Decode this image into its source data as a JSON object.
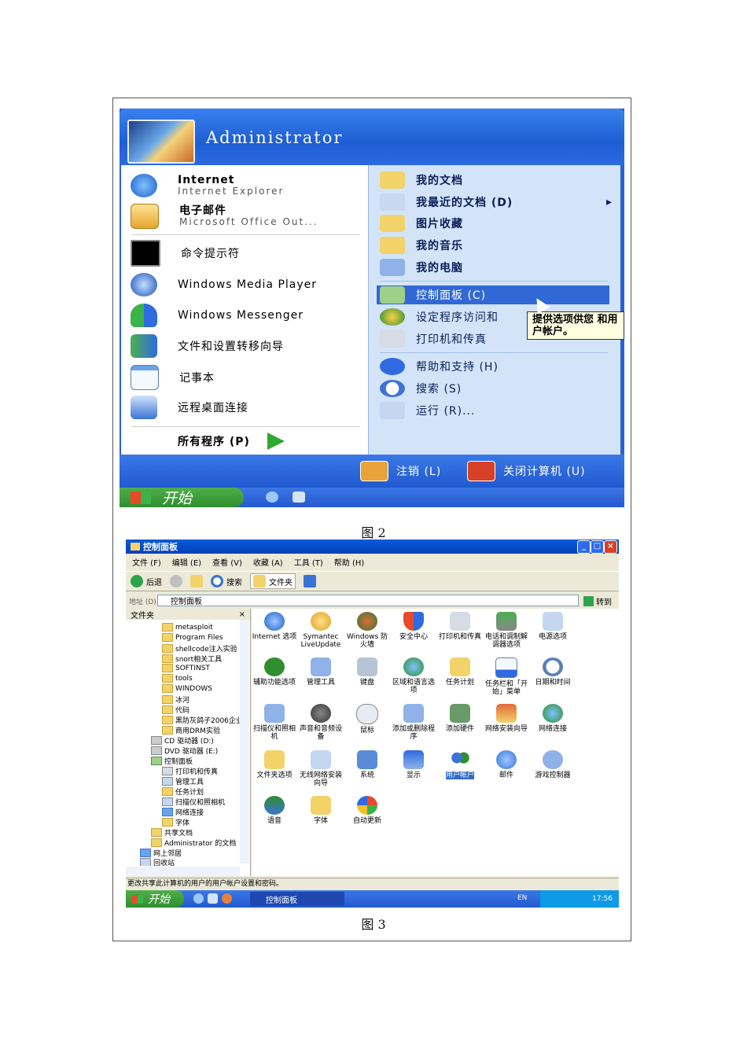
{
  "figure2": {
    "caption": "图 2",
    "user_name": "Administrator",
    "pinned": [
      {
        "title": "Internet",
        "subtitle": "Internet Explorer"
      },
      {
        "title": "电子邮件",
        "subtitle": "Microsoft Office Out..."
      }
    ],
    "recent": [
      "命令提示符",
      "Windows Media Player",
      "Windows Messenger",
      "文件和设置转移向导",
      "记事本",
      "远程桌面连接"
    ],
    "all_programs": "所有程序 (P)",
    "right_items": [
      "我的文档",
      "我最近的文档 (D)",
      "图片收藏",
      "我的音乐",
      "我的电脑",
      "控制面板 (C)",
      "设定程序访问和",
      "打印机和传真",
      "帮助和支持 (H)",
      "搜索 (S)",
      "运行 (R)..."
    ],
    "submenu_arrow": "▸",
    "tooltip": "提供选项供您 和用户帐户。",
    "logoff": "注销 (L)",
    "shutdown": "关闭计算机 (U)",
    "start": "开始"
  },
  "figure3": {
    "caption": "图 3",
    "window_title": "控制面板",
    "menu": [
      "文件 (F)",
      "编辑 (E)",
      "查看 (V)",
      "收藏 (A)",
      "工具 (T)",
      "帮助 (H)"
    ],
    "toolbar": {
      "back": "后退",
      "search": "搜索",
      "folders": "文件夹"
    },
    "address_label": "地址 (D)",
    "address_value": "控制面板",
    "go": "转到",
    "tree_title": "文件夹",
    "tree_close": "×",
    "tree": [
      "metasploit",
      "Program Files",
      "shellcode注入实验",
      "snort相关工具",
      "SOFTINST",
      "tools",
      "WINDOWS",
      "冰河",
      "代码",
      "黑防灰鸽子2006企业",
      "商用DRM实验",
      "CD 驱动器 (D:)",
      "DVD 驱动器 (E:)",
      "控制面板",
      "打印机和传真",
      "管理工具",
      "任务计划",
      "扫描仪和照相机",
      "网络连接",
      "字体",
      "共享文档",
      "Administrator 的文档",
      "网上邻居",
      "回收站"
    ],
    "icons": [
      "Internet 选项",
      "Symantec LiveUpdate",
      "Windows 防火墙",
      "安全中心",
      "打印机和传真",
      "电话和调制解调器选项",
      "电源选项",
      "辅助功能选项",
      "管理工具",
      "键盘",
      "区域和语言选项",
      "任务计划",
      "任务栏和「开始」菜单",
      "日期和时间",
      "扫描仪和照相机",
      "声音和音频设备",
      "鼠标",
      "添加或删除程序",
      "添加硬件",
      "网络安装向导",
      "网络连接",
      "文件夹选项",
      "无线网络安装向导",
      "系统",
      "显示",
      "用户帐户",
      "邮件",
      "游戏控制器",
      "语音",
      "字体",
      "自动更新"
    ],
    "status": "更改共享此计算机的用户的用户帐户设置和密码。",
    "start": "开始",
    "task_button": "控制面板",
    "lang": "EN",
    "clock": "17:56"
  },
  "colors": {
    "xp_blue": "#2a62d6",
    "start_green": "#3a9a36",
    "highlight": "#316ac5"
  }
}
